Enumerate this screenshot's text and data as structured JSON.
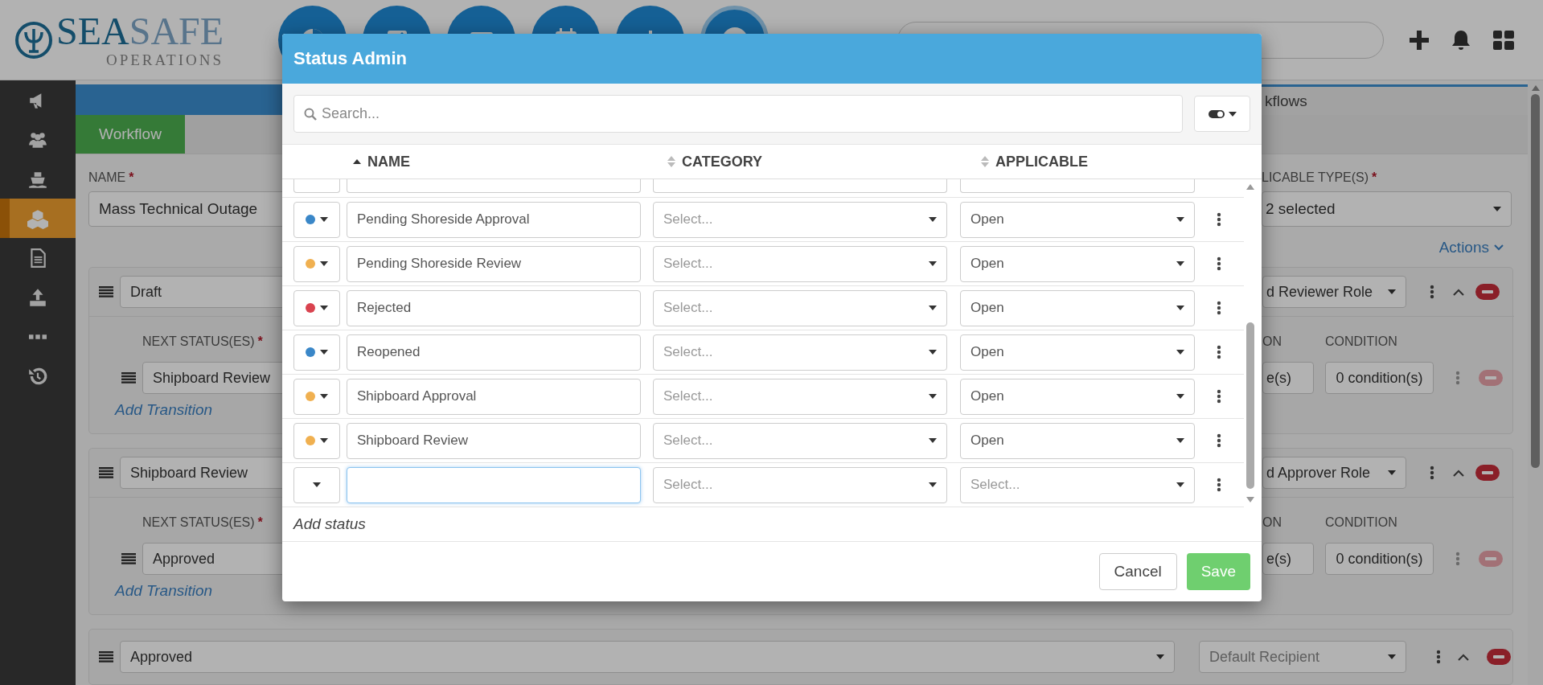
{
  "header": {
    "logo": {
      "word_1": "SEA",
      "word_2": "SAFE",
      "subtitle": "OPERATIONS"
    },
    "nav_buttons": [
      {
        "selected": false
      },
      {
        "selected": false
      },
      {
        "selected": false
      },
      {
        "selected": false
      },
      {
        "selected": false
      },
      {
        "selected": true
      }
    ],
    "search": {
      "kind": "pill"
    }
  },
  "sidebar": {
    "items": [
      {
        "selected": false
      },
      {
        "selected": false
      },
      {
        "selected": false
      },
      {
        "selected": true
      },
      {
        "selected": false
      },
      {
        "selected": false
      },
      {
        "selected": false
      },
      {
        "selected": false
      }
    ]
  },
  "page": {
    "tabs": [
      {
        "selected": true
      },
      {
        "label": "kflows",
        "selected": false
      }
    ],
    "subtabs": [
      {
        "label": "Workflow",
        "selected": true
      }
    ],
    "name_label": "NAME",
    "name_required_mark": "*",
    "name_value": "Mass Technical Outage",
    "types_label": "LICABLE TYPE(S)",
    "types_required_mark": "*",
    "types_value": "2 selected",
    "actions": "Actions",
    "cards": [
      {
        "status": "Draft",
        "role": "d Reviewer Role",
        "transition_label": "NEXT STATUS(ES)",
        "transition_required_mark": "*",
        "next_status": "Shipboard Review",
        "add_transition": "Add Transition",
        "column_3_label": "ON",
        "condition_label": "CONDITION",
        "column_3_value": "e(s)",
        "condition_value": "0 condition(s)"
      },
      {
        "status": "Shipboard Review",
        "role": "d Approver Role",
        "transition_label": "NEXT STATUS(ES)",
        "transition_required_mark": "*",
        "next_status": "Approved",
        "add_transition": "Add Transition",
        "column_3_label": "ON",
        "condition_label": "CONDITION",
        "column_3_value": "e(s)",
        "condition_value": "0 condition(s)"
      },
      {
        "status": "Approved",
        "role": "Default Recipient"
      }
    ]
  },
  "modal": {
    "title": "Status Admin",
    "search_placeholder": "Search...",
    "columns": [
      {
        "label": "NAME",
        "sorted": true
      },
      {
        "label": "CATEGORY",
        "sorted": false
      },
      {
        "label": "APPLICABLE",
        "sorted": false
      }
    ],
    "rows": [
      {
        "kind": "status",
        "color": "#3a87c8",
        "name": "Pending Shoreside Approval",
        "category_placeholder": "Select...",
        "applicable": "Open"
      },
      {
        "kind": "status",
        "color": "#f0b050",
        "name": "Pending Shoreside Review",
        "category_placeholder": "Select...",
        "applicable": "Open"
      },
      {
        "kind": "status",
        "color": "#d9434f",
        "name": "Rejected",
        "category_placeholder": "Select...",
        "applicable": "Open"
      },
      {
        "kind": "status",
        "color": "#3a87c8",
        "name": "Reopened",
        "category_placeholder": "Select...",
        "applicable": "Open"
      },
      {
        "kind": "status",
        "color": "#f0b050",
        "name": "Shipboard Approval",
        "category_placeholder": "Select...",
        "applicable": "Open"
      },
      {
        "kind": "status",
        "color": "#f0b050",
        "name": "Shipboard Review",
        "category_placeholder": "Select...",
        "applicable": "Open"
      },
      {
        "kind": "new",
        "focused": true,
        "category_placeholder": "Select...",
        "applicable_placeholder": "Select..."
      }
    ],
    "add_status": "Add status",
    "buttons": [
      {
        "kind": "cancel",
        "label": "Cancel"
      },
      {
        "kind": "save",
        "label": "Save"
      }
    ]
  }
}
